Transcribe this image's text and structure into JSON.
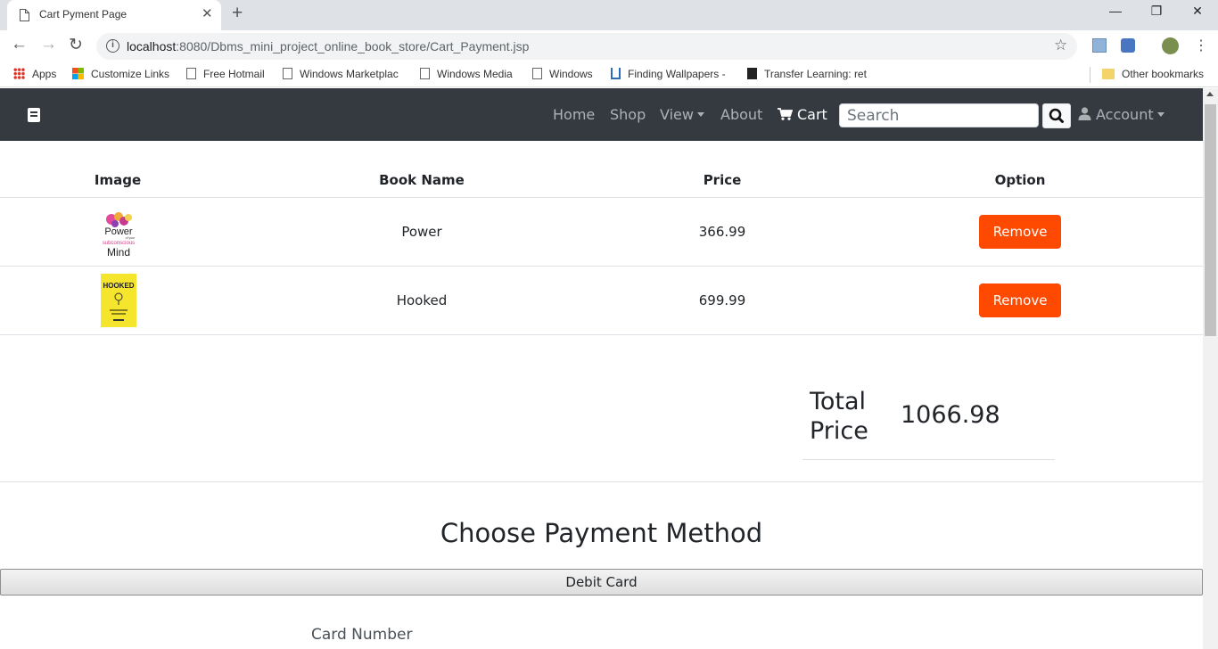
{
  "browser": {
    "tab_title": "Cart Pyment Page",
    "url_host": "localhost",
    "url_path": ":8080/Dbms_mini_project_online_book_store/Cart_Payment.jsp",
    "bookmarks": [
      {
        "label": "Apps",
        "icon": "apps-icon"
      },
      {
        "label": "Customize Links",
        "icon": "microsoft-icon"
      },
      {
        "label": "Free Hotmail",
        "icon": "page-icon"
      },
      {
        "label": "Windows Marketplac",
        "icon": "page-icon"
      },
      {
        "label": "Windows Media",
        "icon": "page-icon"
      },
      {
        "label": "Windows",
        "icon": "page-icon"
      },
      {
        "label": "Finding Wallpapers -",
        "icon": "site-icon"
      },
      {
        "label": "Transfer Learning: ret",
        "icon": "site-icon"
      }
    ],
    "other_bookmarks": "Other bookmarks"
  },
  "navbar": {
    "links": [
      "Home",
      "Shop",
      "View",
      "About",
      "Cart"
    ],
    "search_placeholder": "Search",
    "account": "Account"
  },
  "cart": {
    "headers": [
      "Image",
      "Book Name",
      "Price",
      "Option"
    ],
    "rows": [
      {
        "name": "Power",
        "price": "366.99",
        "option": "Remove",
        "cover_text": [
          "Power",
          "of your",
          "subconscious",
          "Mind"
        ]
      },
      {
        "name": "Hooked",
        "price": "699.99",
        "option": "Remove",
        "cover_text": [
          "HOOKED"
        ]
      }
    ],
    "total_label": "Total Price",
    "total_value": "1066.98"
  },
  "payment": {
    "title": "Choose Payment Method",
    "method_button": "Debit Card",
    "card_number_label": "Card Number"
  },
  "colors": {
    "navbar_bg": "#343a40",
    "remove_btn": "#fe4a00"
  }
}
